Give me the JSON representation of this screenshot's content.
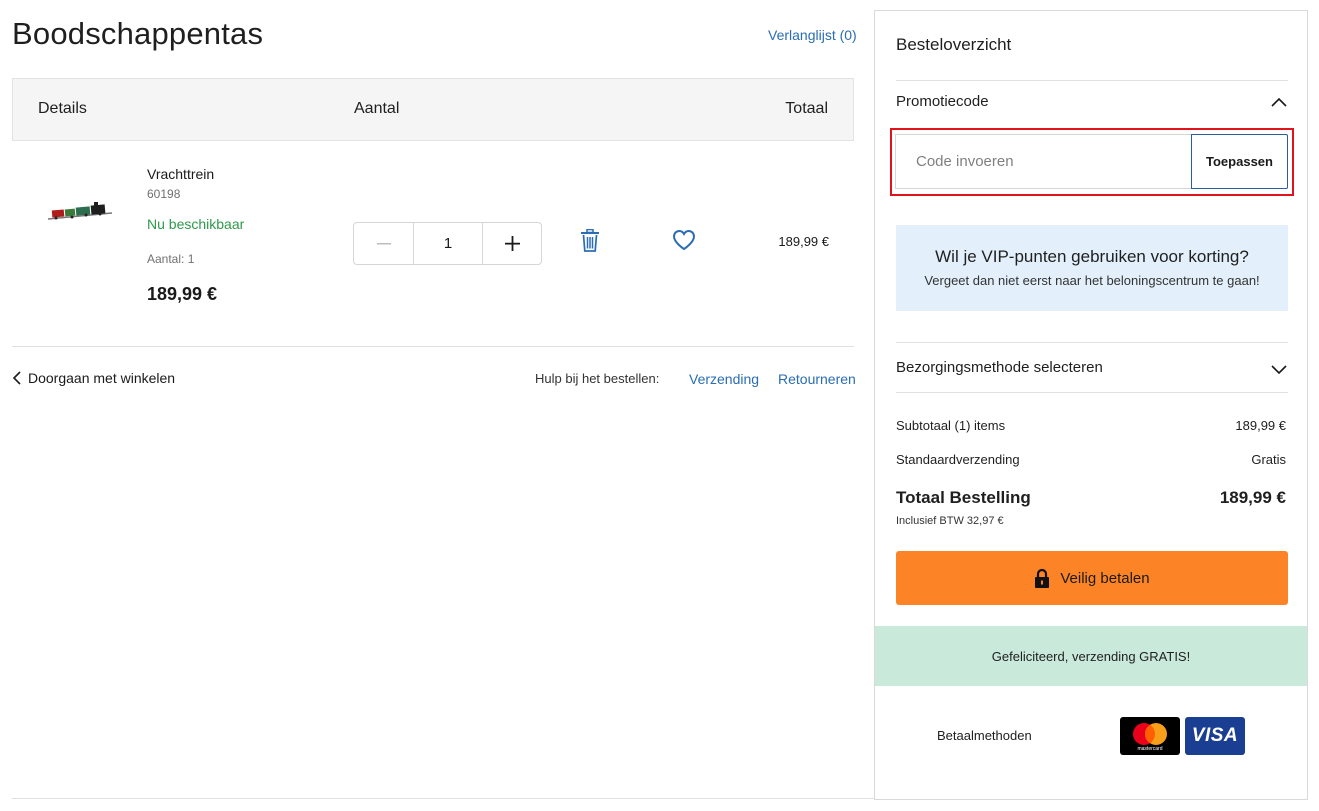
{
  "page": {
    "title": "Boodschappentas",
    "wishlist_link": "Verlanglijst (0)"
  },
  "cart_header": {
    "details": "Details",
    "quantity": "Aantal",
    "total": "Totaal"
  },
  "item": {
    "name": "Vrachttrein",
    "sku": "60198",
    "availability": "Nu beschikbaar",
    "quantity_label": "Aantal: 1",
    "price": "189,99 €",
    "quantity": "1",
    "line_total": "189,99 €"
  },
  "footer_links": {
    "continue": "Doorgaan met winkelen",
    "help_label": "Hulp bij het bestellen:",
    "shipping": "Verzending",
    "returns": "Retourneren"
  },
  "summary": {
    "title": "Besteloverzicht",
    "promo_label": "Promotiecode",
    "promo_placeholder": "Code invoeren",
    "promo_apply": "Toepassen",
    "vip_title": "Wil je VIP-punten gebruiken voor korting?",
    "vip_subtitle": "Vergeet dan niet eerst naar het beloningscentrum te gaan!",
    "delivery_label": "Bezorgingsmethode selecteren",
    "subtotal_label": "Subtotaal (1) items",
    "subtotal_value": "189,99 €",
    "shipping_label": "Standaardverzending",
    "shipping_value": "Gratis",
    "total_label": "Totaal Bestelling",
    "total_value": "189,99 €",
    "vat_note": "Inclusief BTW 32,97 €",
    "pay_button": "Veilig betalen",
    "free_shipping_banner": "Gefeliciteerd, verzending GRATIS!",
    "payment_methods_label": "Betaalmethoden",
    "mastercard_text": "mastercard",
    "visa_text": "VISA"
  },
  "colors": {
    "link_blue": "#2a6db5",
    "available_green": "#2e9a4c",
    "pay_orange": "#fd8426",
    "vip_blue": "#e3f0fb",
    "free_banner_green": "#c9eada",
    "highlight_red": "#e0141b"
  }
}
